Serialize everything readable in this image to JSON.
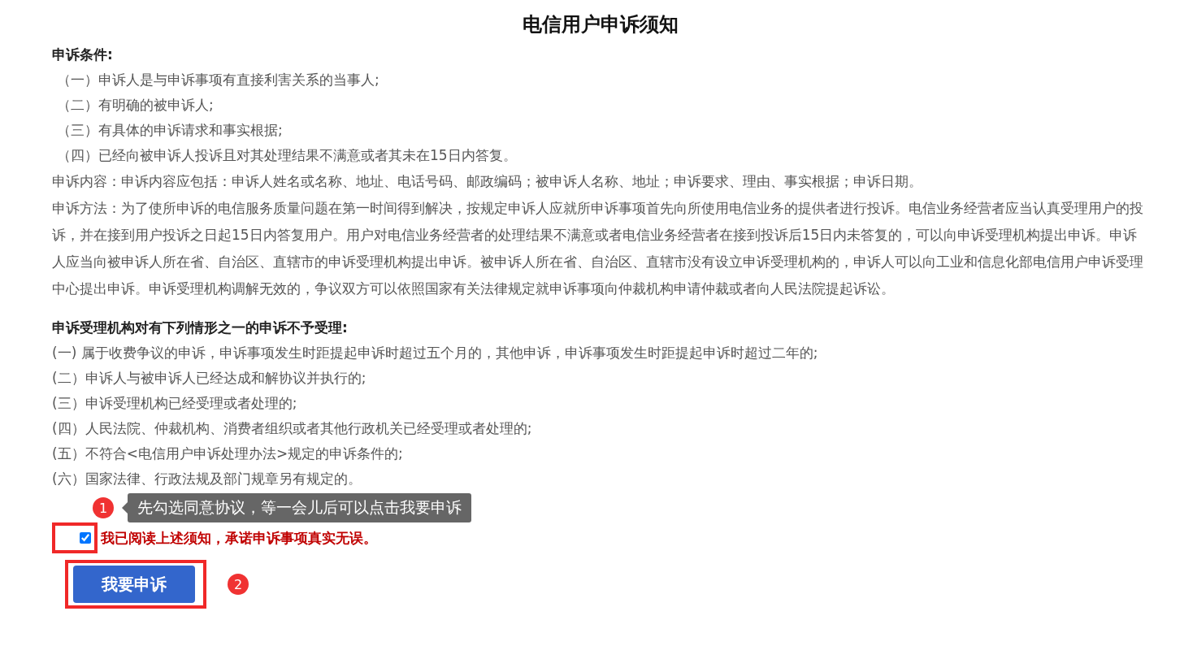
{
  "title": "电信用户申诉须知",
  "conditions": {
    "heading": "申诉条件:",
    "items": [
      "（一）申诉人是与申诉事项有直接利害关系的当事人;",
      "（二）有明确的被申诉人;",
      "（三）有具体的申诉请求和事实根据;",
      "（四）已经向被申诉人投诉且对其处理结果不满意或者其未在15日内答复。"
    ]
  },
  "paragraphs": [
    "申诉内容：申诉内容应包括：申诉人姓名或名称、地址、电话号码、邮政编码；被申诉人名称、地址；申诉要求、理由、事实根据；申诉日期。",
    "申诉方法：为了使所申诉的电信服务质量问题在第一时间得到解决，按规定申诉人应就所申诉事项首先向所使用电信业务的提供者进行投诉。电信业务经营者应当认真受理用户的投诉，并在接到用户投诉之日起15日内答复用户。用户对电信业务经营者的处理结果不满意或者电信业务经营者在接到投诉后15日内未答复的，可以向申诉受理机构提出申诉。申诉人应当向被申诉人所在省、自治区、直辖市的申诉受理机构提出申诉。被申诉人所在省、自治区、直辖市没有设立申诉受理机构的，申诉人可以向工业和信息化部电信用户申诉受理中心提出申诉。申诉受理机构调解无效的，争议双方可以依照国家有关法律规定就申诉事项向仲裁机构申请仲裁或者向人民法院提起诉讼。"
  ],
  "rejections": {
    "heading": "申诉受理机构对有下列情形之一的申诉不予受理:",
    "items": [
      "(一) 属于收费争议的申诉，申诉事项发生时距提起申诉时超过五个月的，其他申诉，申诉事项发生时距提起申诉时超过二年的;",
      "(二）申诉人与被申诉人已经达成和解协议并执行的;",
      "(三）申诉受理机构已经受理或者处理的;",
      "(四）人民法院、仲裁机构、消费者组织或者其他行政机关已经受理或者处理的;",
      "(五）不符合<电信用户申诉处理办法>规定的申诉条件的;",
      "(六）国家法律、行政法规及部门规章另有规定的。"
    ]
  },
  "tooltip": {
    "marker": "1",
    "text": "先勾选同意协议，等一会儿后可以点击我要申诉"
  },
  "agreement": {
    "checked": true,
    "label": "我已阅读上述须知，承诺申诉事项真实无误。"
  },
  "submit": {
    "label": "我要申诉",
    "marker": "2"
  }
}
